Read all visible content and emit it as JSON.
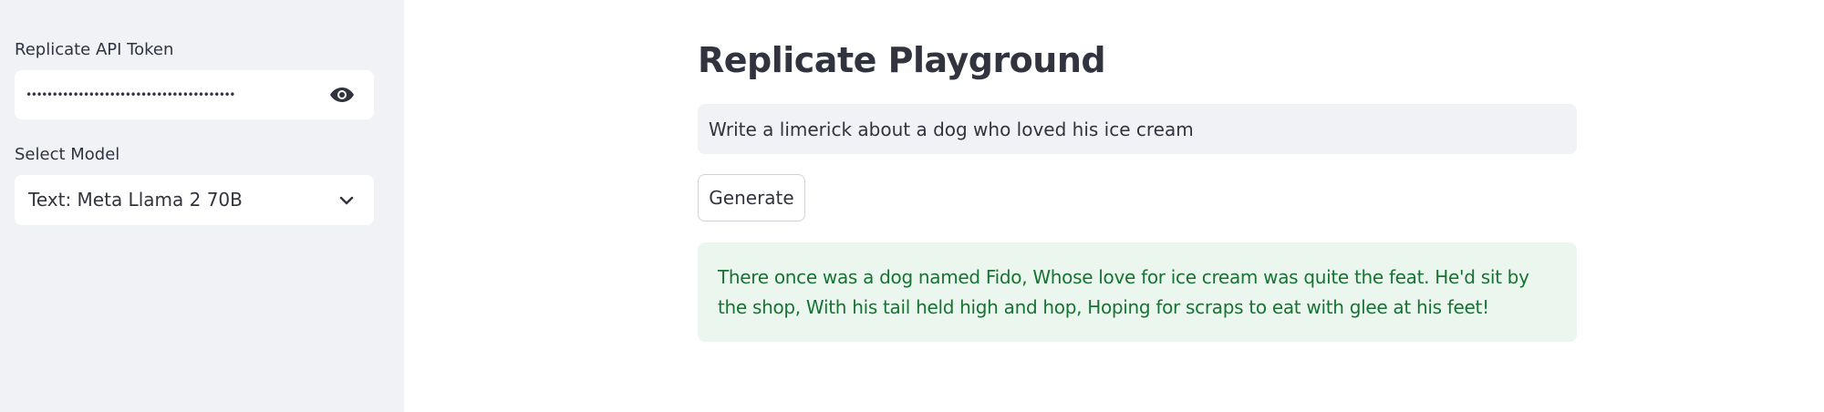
{
  "sidebar": {
    "token_label": "Replicate API Token",
    "token_value": "••••••••••••••••••••••••••••••••••••••••",
    "model_label": "Select Model",
    "model_selected": "Text: Meta Llama 2 70B"
  },
  "main": {
    "title": "Replicate Playground",
    "prompt_value": "Write a limerick about a dog who loved his ice cream",
    "generate_label": "Generate",
    "result_text": "There once was a dog named Fido, Whose love for ice cream was quite the feat. He'd sit by the shop, With his tail held high and hop, Hoping for scraps to eat with glee at his feet!"
  },
  "icons": {
    "password_toggle": "eye-icon",
    "select_caret": "chevron-down-icon"
  },
  "colors": {
    "sidebar_bg": "#f0f2f6",
    "success_bg": "#ebf7ee",
    "success_text": "#177233",
    "text": "#31333f"
  }
}
